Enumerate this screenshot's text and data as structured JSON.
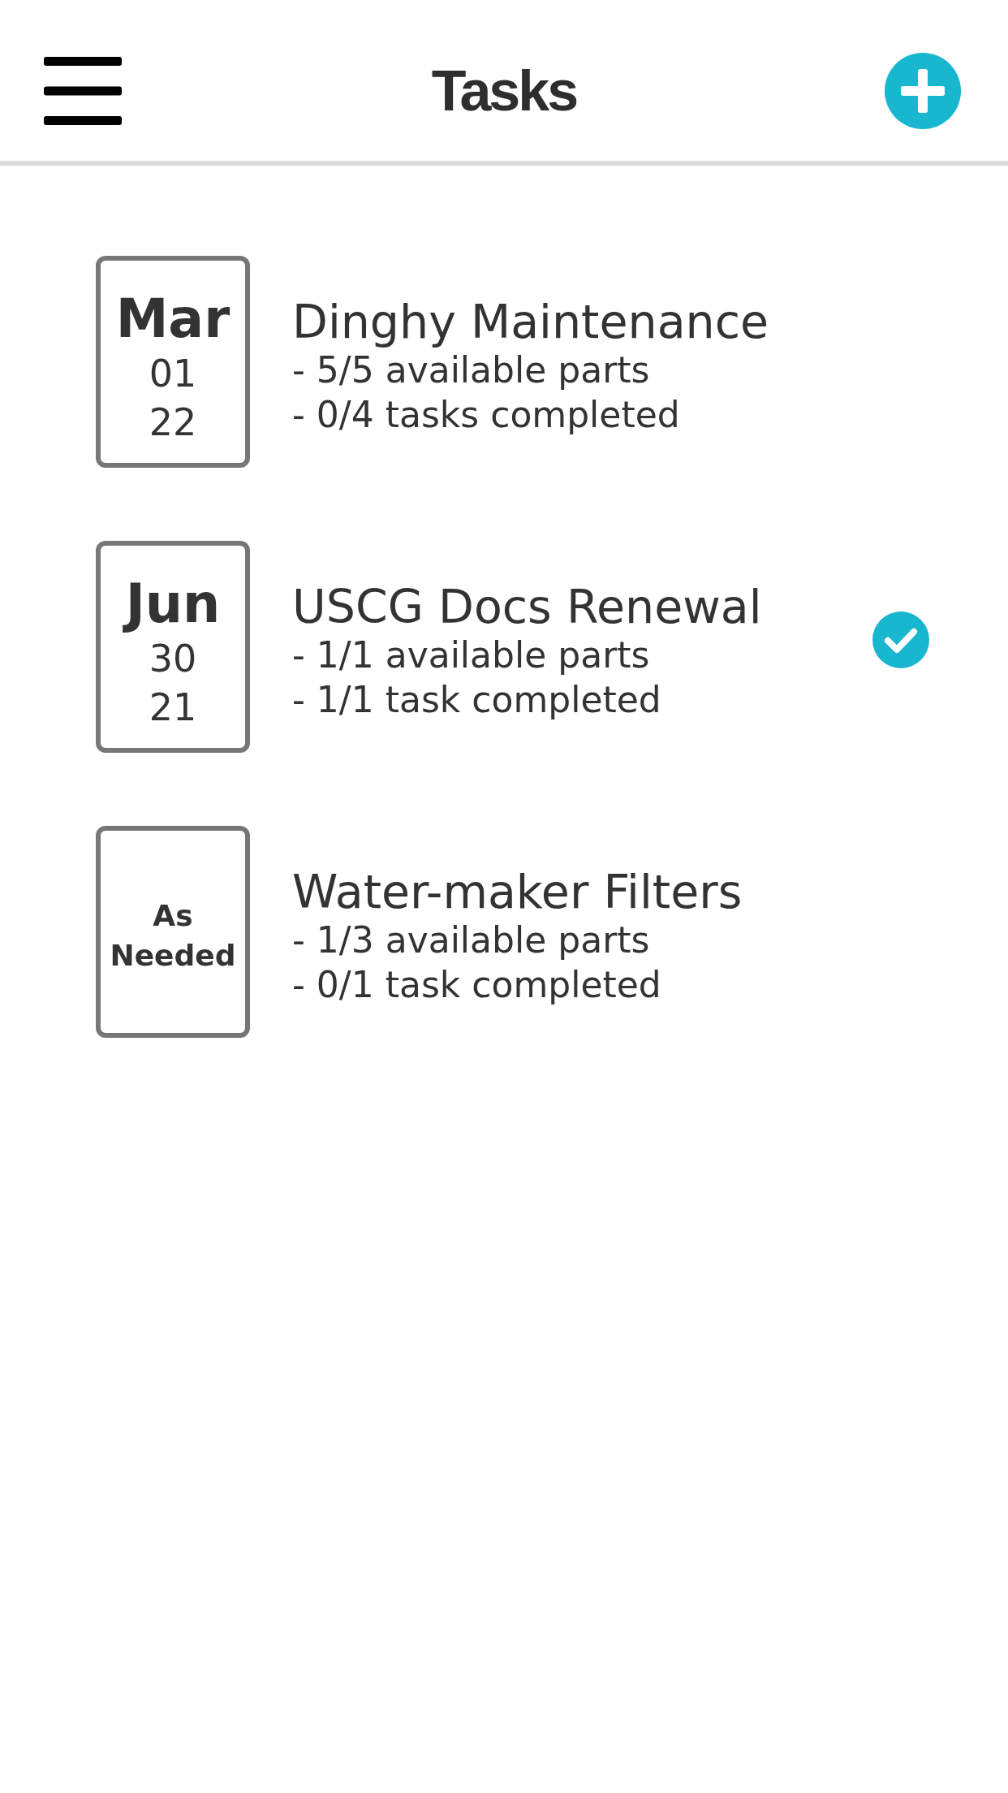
{
  "header": {
    "title": "Tasks"
  },
  "tasks": [
    {
      "kind": "dated",
      "month": "Mar",
      "day": "01",
      "year": "22",
      "title": "Dinghy Maintenance",
      "parts": "- 5/5 available parts",
      "tasks_done": "- 0/4 tasks completed",
      "completed": false
    },
    {
      "kind": "dated",
      "month": "Jun",
      "day": "30",
      "year": "21",
      "title": "USCG Docs Renewal",
      "parts": "- 1/1 available parts",
      "tasks_done": "- 1/1 task completed",
      "completed": true
    },
    {
      "kind": "as_needed",
      "schedule": "As Needed",
      "title": "Water-maker Filters",
      "parts": "- 1/3 available parts",
      "tasks_done": "- 0/1 task completed",
      "completed": false
    }
  ]
}
